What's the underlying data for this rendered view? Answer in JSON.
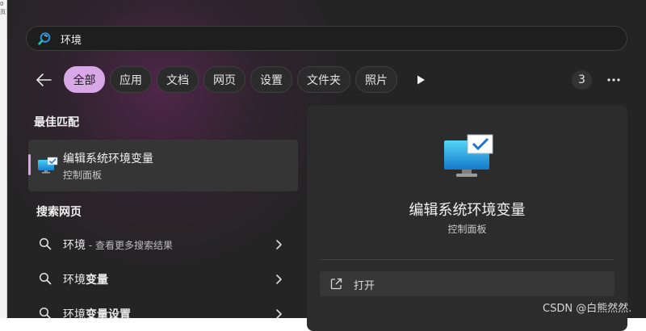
{
  "search": {
    "query": "环境"
  },
  "filters": {
    "items": [
      {
        "label": "全部",
        "active": true
      },
      {
        "label": "应用"
      },
      {
        "label": "文档"
      },
      {
        "label": "网页"
      },
      {
        "label": "设置"
      },
      {
        "label": "文件夹"
      },
      {
        "label": "照片"
      }
    ],
    "count": "3"
  },
  "best_match": {
    "heading": "最佳匹配",
    "title": "编辑系统环境变量",
    "subtitle": "控制面板"
  },
  "web": {
    "heading": "搜索网页",
    "rows": [
      {
        "main": "环境",
        "suffix": " - 查看更多搜索结果"
      },
      {
        "main": "环境",
        "bold": "变量"
      },
      {
        "main": "环境",
        "bold": "变量设置"
      }
    ]
  },
  "preview": {
    "title": "编辑系统环境变量",
    "subtitle": "控制面板",
    "action_label": "打开"
  },
  "left_strip": [
    "0",
    "页"
  ],
  "watermark": "CSDN @白熊然然."
}
